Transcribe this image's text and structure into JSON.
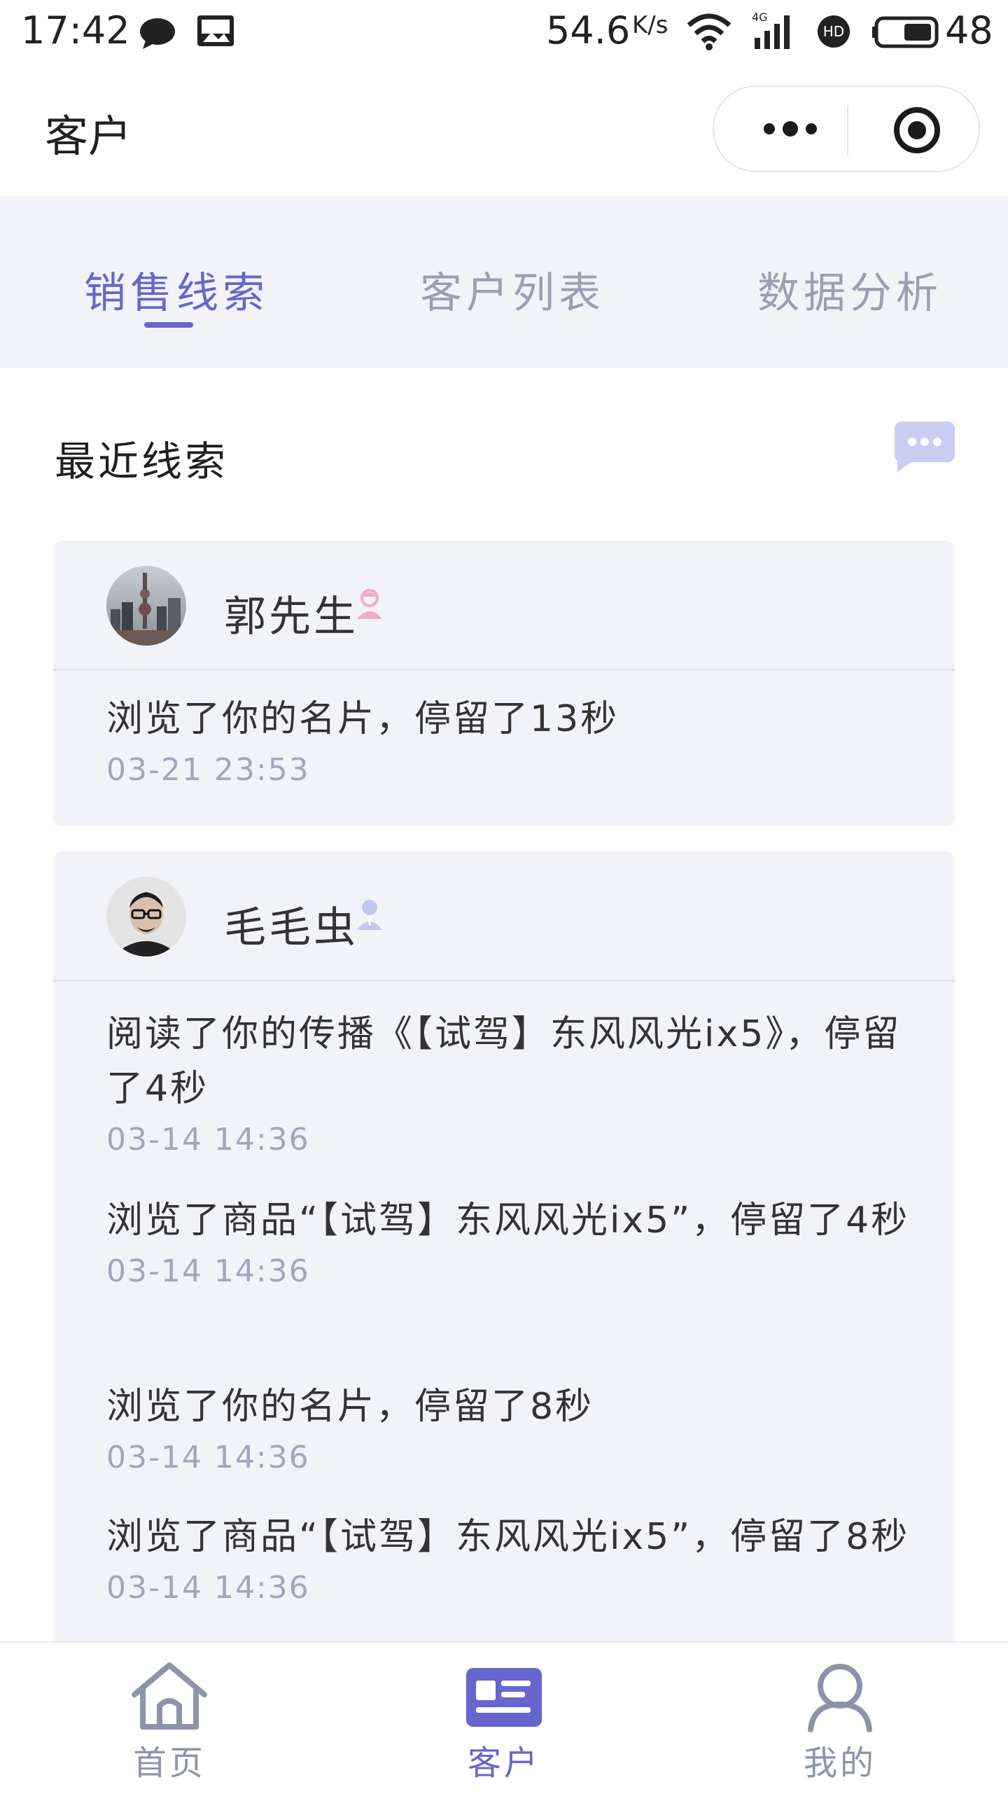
{
  "status_bar": {
    "time": "17:42",
    "net_speed": "54.6",
    "net_speed_unit": "K/s",
    "battery_level": "48",
    "network": "4G",
    "icons": [
      "chat-notification-icon",
      "image-notification-icon",
      "wifi-icon",
      "signal-icon",
      "hd-icon",
      "battery-icon"
    ]
  },
  "header": {
    "title": "客户",
    "capsule": {
      "more_icon": "more-dots-icon",
      "close_icon": "target-icon"
    }
  },
  "tabs": [
    {
      "label": "销售线索",
      "active": true
    },
    {
      "label": "客户列表",
      "active": false
    },
    {
      "label": "数据分析",
      "active": false
    }
  ],
  "section": {
    "title": "最近线索",
    "action_icon": "message-bubble-icon"
  },
  "leads": [
    {
      "name": "郭先生",
      "gender_icon": "female-icon",
      "avatar": "city-skyline-avatar",
      "activities": [
        {
          "text": "浏览了你的名片，停留了13秒",
          "time": "03-21 23:53"
        }
      ]
    },
    {
      "name": "毛毛虫",
      "gender_icon": "male-icon",
      "avatar": "man-with-glasses-avatar",
      "activities": [
        {
          "text": "阅读了你的传播《【试驾】东风风光ix5》，停留了4秒",
          "time": "03-14 14:36"
        },
        {
          "text": "浏览了商品“【试驾】东风风光ix5”，停留了4秒",
          "time": "03-14 14:36"
        },
        {
          "text": "浏览了你的名片，停留了8秒",
          "time": "03-14 14:36"
        },
        {
          "text": "浏览了商品“【试驾】东风风光ix5”，停留了8秒",
          "time": "03-14 14:36"
        }
      ]
    }
  ],
  "bottom_nav": [
    {
      "label": "首页",
      "icon": "home-icon",
      "active": false
    },
    {
      "label": "客户",
      "icon": "customer-card-icon",
      "active": true
    },
    {
      "label": "我的",
      "icon": "user-icon",
      "active": false
    }
  ],
  "colors": {
    "accent": "#6666CC",
    "inactive": "#9B9FB3",
    "card_bg": "#F2F3F8",
    "time_text": "#A2A6BD"
  }
}
